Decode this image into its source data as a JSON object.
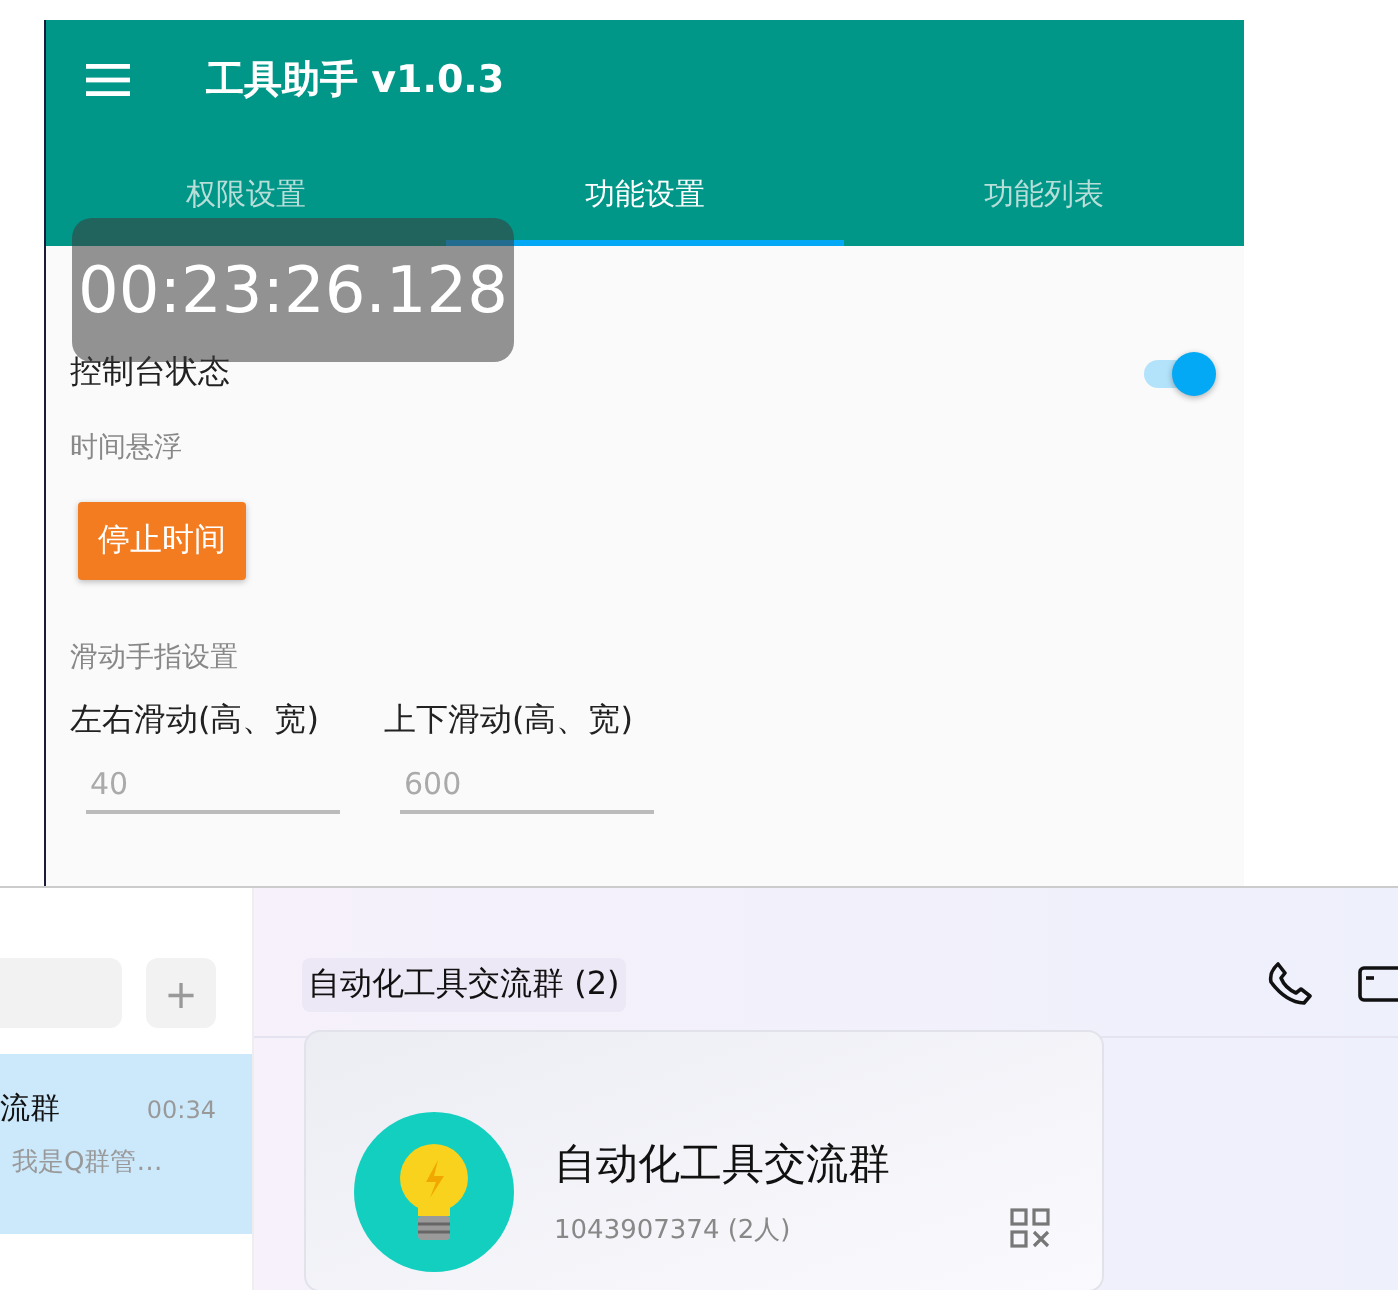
{
  "phone_app": {
    "title": "工具助手 v1.0.3",
    "tabs": [
      {
        "label": "权限设置",
        "selected": false
      },
      {
        "label": "功能设置",
        "selected": true
      },
      {
        "label": "功能列表",
        "selected": false
      }
    ],
    "timer": "00:23:26.128",
    "console": {
      "label": "控制台状态",
      "on": true
    },
    "float_label": "时间悬浮",
    "stop_button": "停止时间",
    "swipe_label": "滑动手指设置",
    "swipe_fields": [
      {
        "label": "左右滑动(高、宽)",
        "placeholder": "40"
      },
      {
        "label": "上下滑动(高、宽)",
        "placeholder": "600"
      }
    ]
  },
  "chat_window": {
    "add_button": "+",
    "conversations": [
      {
        "name": "流群",
        "time": "00:34",
        "preview": "我是Q群管…",
        "selected": true
      }
    ],
    "chat_title": "自动化工具交流群 (2)",
    "group_card": {
      "name": "自动化工具交流群",
      "number": "1043907374 (2人)"
    }
  }
}
